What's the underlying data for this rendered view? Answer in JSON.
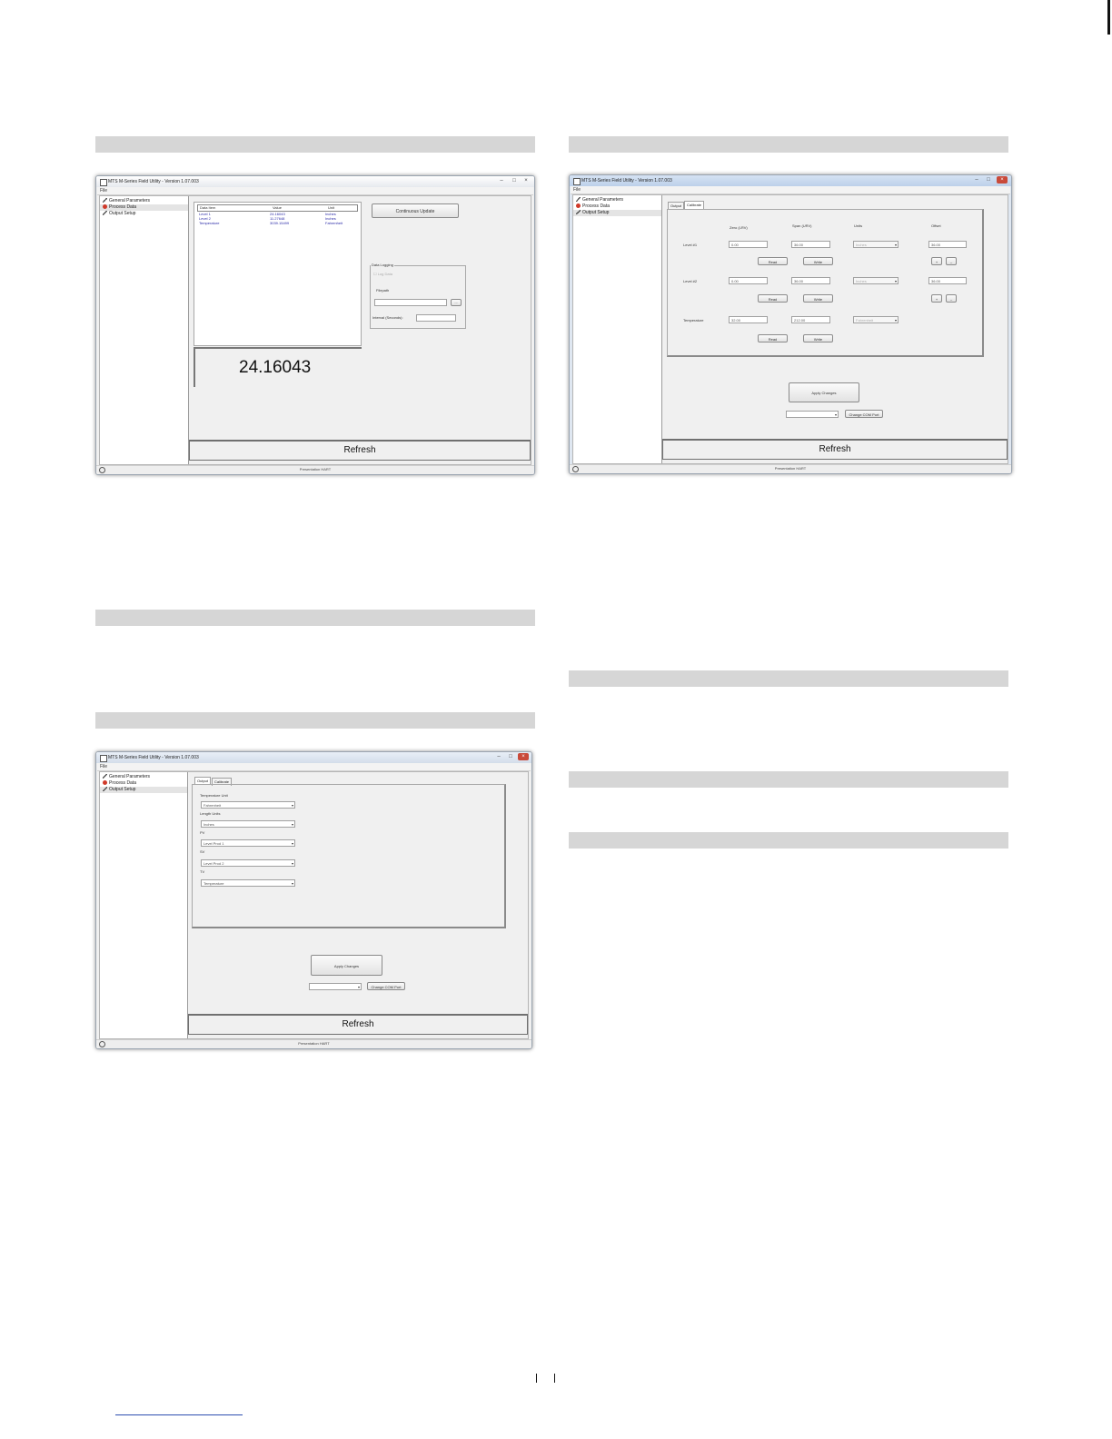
{
  "app_title": "MTS M-Series Field Utility - Version 1.07.003",
  "app_title_short": "MTS M-Series Field Utility - Version 1.07.003",
  "menu_file": "File",
  "nav": [
    "General Parameters",
    "Process Data",
    "Output Setup"
  ],
  "status_text": "Presentation HART",
  "refresh_label": "Refresh",
  "window_buttons": {
    "minimize": "–",
    "maximize": "□",
    "close": "×"
  },
  "process": {
    "table_headers": [
      "Data Item",
      "Value",
      "Unit"
    ],
    "rows": [
      {
        "item": "Level 1",
        "value": "24.16043",
        "unit": "Inches"
      },
      {
        "item": "Level 2",
        "value": "11.27648",
        "unit": "Inches"
      },
      {
        "item": "Temperature",
        "value": "3039.15499",
        "unit": "Fahrenheit"
      }
    ],
    "big_value": "24.16043",
    "continuous_update": "Continuous Update",
    "data_logging": "Data Logging",
    "log_data_checkbox": "Log Data",
    "filepath_label": "Filepath",
    "browse": "...",
    "interval_label": "Interval (Seconds):"
  },
  "output": {
    "tabs": [
      "Output",
      "Calibrate"
    ],
    "fields": [
      {
        "label": "Temperature Unit",
        "value": "Fahrenheit"
      },
      {
        "label": "Length Units",
        "value": "Inches"
      },
      {
        "label": "PV",
        "value": "Level Prod 1"
      },
      {
        "label": "SV",
        "value": "Level Prod 2"
      },
      {
        "label": "TV",
        "value": "Temperature"
      }
    ],
    "apply_changes": "Apply Changes",
    "change_com_port": "Change COM Port"
  },
  "calibrate": {
    "tabs": [
      "Output",
      "Calibrate"
    ],
    "columns": [
      "Zero (LRV)",
      "Span (URV)",
      "Units",
      "Offset"
    ],
    "rows": [
      {
        "label": "Level #1",
        "zero": "0.00",
        "span": "36.00",
        "unit": "Inches",
        "offset": "36.00"
      },
      {
        "label": "Level #2",
        "zero": "0.00",
        "span": "36.00",
        "unit": "Inches",
        "offset": "36.00"
      },
      {
        "label": "Temperature",
        "zero": "32.00",
        "span": "212.00",
        "unit": "Fahrenheit",
        "offset": ""
      }
    ],
    "read": "Read",
    "write": "Write",
    "plus": "+",
    "minus": "–",
    "apply_changes": "Apply Changes",
    "change_com_port": "Change COM Port"
  }
}
